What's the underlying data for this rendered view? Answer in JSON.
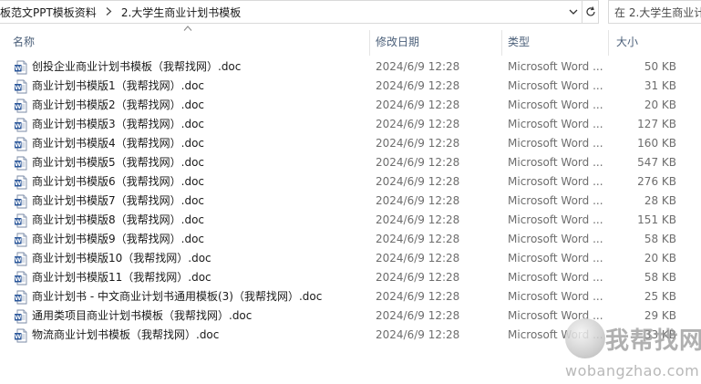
{
  "address_bar": {
    "crumbs": [
      "板范文PPT模板资料",
      "2.大学生商业计划书模板"
    ],
    "search_placeholder": "在 2.大学生商业计"
  },
  "columns": {
    "name": "名称",
    "date": "修改日期",
    "type": "类型",
    "size": "大小"
  },
  "files": [
    {
      "name": "创投企业商业计划书模板（我帮找网）.doc",
      "date": "2024/6/9 12:28",
      "type": "Microsoft Word ...",
      "size": "50 KB"
    },
    {
      "name": "商业计划书模版1（我帮找网）.doc",
      "date": "2024/6/9 12:28",
      "type": "Microsoft Word ...",
      "size": "31 KB"
    },
    {
      "name": "商业计划书模版2（我帮找网）.doc",
      "date": "2024/6/9 12:28",
      "type": "Microsoft Word ...",
      "size": "20 KB"
    },
    {
      "name": "商业计划书模版3（我帮找网）.doc",
      "date": "2024/6/9 12:28",
      "type": "Microsoft Word ...",
      "size": "127 KB"
    },
    {
      "name": "商业计划书模版4（我帮找网）.doc",
      "date": "2024/6/9 12:28",
      "type": "Microsoft Word ...",
      "size": "160 KB"
    },
    {
      "name": "商业计划书模版5（我帮找网）.doc",
      "date": "2024/6/9 12:28",
      "type": "Microsoft Word ...",
      "size": "547 KB"
    },
    {
      "name": "商业计划书模版6（我帮找网）.doc",
      "date": "2024/6/9 12:28",
      "type": "Microsoft Word ...",
      "size": "276 KB"
    },
    {
      "name": "商业计划书模版7（我帮找网）.doc",
      "date": "2024/6/9 12:28",
      "type": "Microsoft Word ...",
      "size": "28 KB"
    },
    {
      "name": "商业计划书模版8（我帮找网）.doc",
      "date": "2024/6/9 12:28",
      "type": "Microsoft Word ...",
      "size": "151 KB"
    },
    {
      "name": "商业计划书模版9（我帮找网）.doc",
      "date": "2024/6/9 12:28",
      "type": "Microsoft Word ...",
      "size": "58 KB"
    },
    {
      "name": "商业计划书模版10（我帮找网）.doc",
      "date": "2024/6/9 12:28",
      "type": "Microsoft Word ...",
      "size": "20 KB"
    },
    {
      "name": "商业计划书模版11（我帮找网）.doc",
      "date": "2024/6/9 12:28",
      "type": "Microsoft Word ...",
      "size": "58 KB"
    },
    {
      "name": "商业计划书 - 中文商业计划书通用模板(3)（我帮找网）.doc",
      "date": "2024/6/9 12:28",
      "type": "Microsoft Word ...",
      "size": "25 KB"
    },
    {
      "name": "通用类项目商业计划书模板（我帮找网）.doc",
      "date": "2024/6/9 12:28",
      "type": "Microsoft Word ...",
      "size": "29 KB"
    },
    {
      "name": "物流商业计划书模板（我帮找网）.doc",
      "date": "2024/6/9 12:28",
      "type": "Microsoft Word ...",
      "size": "33 KB"
    }
  ],
  "watermark": {
    "text": "我帮找网",
    "domain": "wobangzhao.com"
  },
  "icons": {
    "file": "word-document-icon",
    "sort": "sort-ascending-icon",
    "dropdown": "chevron-down-icon",
    "refresh": "refresh-icon",
    "breadcrumb_sep": "chevron-right-icon"
  },
  "colors": {
    "header_text": "#4c607a",
    "detail_text": "#6d6d6d",
    "word_blue": "#2b579a"
  }
}
